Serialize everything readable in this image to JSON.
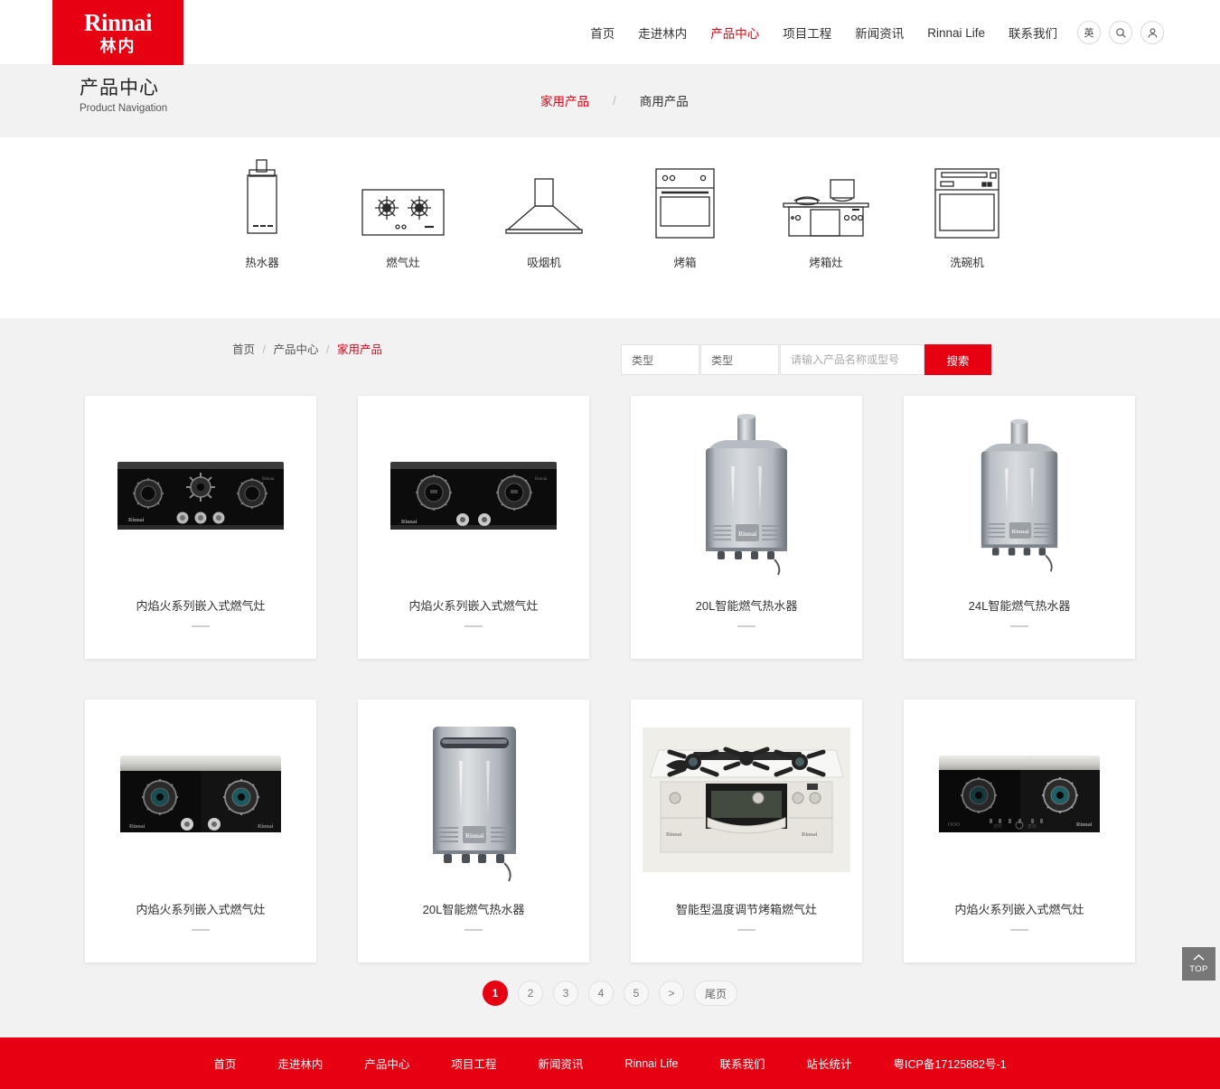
{
  "colors": {
    "brand_red": "#e60012",
    "page_bg": "#f2f2f2",
    "card_bg": "#ffffff",
    "top_btn": "#777777"
  },
  "header": {
    "logo": {
      "en": "Rinnai",
      "cn": "林内"
    },
    "nav": [
      {
        "label": "首页",
        "active": false
      },
      {
        "label": "走进林内",
        "active": false
      },
      {
        "label": "产品中心",
        "active": true
      },
      {
        "label": "项目工程",
        "active": false
      },
      {
        "label": "新闻资讯",
        "active": false
      },
      {
        "label": "Rinnai Life",
        "active": false
      },
      {
        "label": "联系我们",
        "active": false
      }
    ],
    "lang_button": "英",
    "search_icon": "search-icon",
    "user_icon": "user-icon"
  },
  "titlebar": {
    "title_cn": "产品中心",
    "title_en": "Product Navigation",
    "tabs": [
      {
        "label": "家用产品",
        "active": true
      },
      {
        "label": "商用产品",
        "active": false
      }
    ],
    "tab_separator": "/"
  },
  "categories": {
    "prev_arrow": "chevron-left-icon",
    "next_arrow": "chevron-right-icon",
    "items": [
      {
        "label": "热水器",
        "icon": "water-heater-icon"
      },
      {
        "label": "燃气灶",
        "icon": "gas-stove-icon"
      },
      {
        "label": "吸烟机",
        "icon": "range-hood-icon"
      },
      {
        "label": "烤箱",
        "icon": "oven-icon"
      },
      {
        "label": "烤箱灶",
        "icon": "oven-range-icon"
      },
      {
        "label": "洗碗机",
        "icon": "dishwasher-icon"
      }
    ]
  },
  "breadcrumb": [
    {
      "label": "首页",
      "active": false
    },
    {
      "label": "产品中心",
      "active": false
    },
    {
      "label": "家用产品",
      "active": true
    }
  ],
  "breadcrumb_separator": "/",
  "search": {
    "select1_value": "类型",
    "select2_value": "类型",
    "input_value": "",
    "input_placeholder": "请输入产品名称或型号",
    "button_label": "搜索"
  },
  "products": [
    {
      "name": "内焰火系列嵌入式燃气灶",
      "image": "gas-stove-3-burner-black"
    },
    {
      "name": "内焰火系列嵌入式燃气灶",
      "image": "gas-stove-2-burner-black"
    },
    {
      "name": "20L智能燃气热水器",
      "image": "water-heater-silver-flue"
    },
    {
      "name": "24L智能燃气热水器",
      "image": "water-heater-silver-flue"
    },
    {
      "name": "内焰火系列嵌入式燃气灶",
      "image": "gas-stove-2-burner-silver-back"
    },
    {
      "name": "20L智能燃气热水器",
      "image": "water-heater-outdoor-silver"
    },
    {
      "name": "智能型温度调节烤箱燃气灶",
      "image": "oven-range-white"
    },
    {
      "name": "内焰火系列嵌入式燃气灶",
      "image": "gas-stove-2-burner-touch"
    }
  ],
  "pagination": {
    "pages": [
      "1",
      "2",
      "3",
      "4",
      "5"
    ],
    "current": "1",
    "next_label": ">",
    "last_label": "尾页"
  },
  "top_button": {
    "label": "TOP",
    "icon": "chevron-up-icon"
  },
  "footer": {
    "links": [
      "首页",
      "走进林内",
      "产品中心",
      "项目工程",
      "新闻资讯",
      "Rinnai Life",
      "联系我们",
      "站长统计"
    ],
    "icp": "粤ICP备17125882号-1"
  }
}
